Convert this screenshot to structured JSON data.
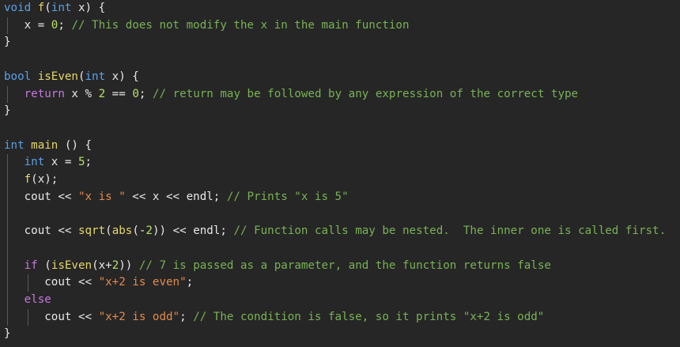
{
  "editor": {
    "theme": {
      "background": "#262626",
      "keyword": "#5aa0e6",
      "control": "#c678dd",
      "function": "#e6d66a",
      "number": "#b5e06a",
      "string": "#e28a4c",
      "comment": "#78b255",
      "text": "#e8e8e8"
    },
    "lines": [
      [
        {
          "c": "kw",
          "t": "void"
        },
        {
          "c": "tx",
          "t": " "
        },
        {
          "c": "fn",
          "t": "f"
        },
        {
          "c": "tx",
          "t": "("
        },
        {
          "c": "kw",
          "t": "int"
        },
        {
          "c": "tx",
          "t": " x) {"
        }
      ],
      [
        {
          "c": "tx",
          "t": "   x = "
        },
        {
          "c": "num",
          "t": "0"
        },
        {
          "c": "tx",
          "t": "; "
        },
        {
          "c": "cm",
          "t": "// This does not modify the x in the main function"
        }
      ],
      [
        {
          "c": "tx",
          "t": "}"
        }
      ],
      [],
      [
        {
          "c": "kw",
          "t": "bool"
        },
        {
          "c": "tx",
          "t": " "
        },
        {
          "c": "fn",
          "t": "isEven"
        },
        {
          "c": "tx",
          "t": "("
        },
        {
          "c": "kw",
          "t": "int"
        },
        {
          "c": "tx",
          "t": " x) {"
        }
      ],
      [
        {
          "c": "tx",
          "t": "   "
        },
        {
          "c": "kw2",
          "t": "return"
        },
        {
          "c": "tx",
          "t": " x % "
        },
        {
          "c": "num",
          "t": "2"
        },
        {
          "c": "tx",
          "t": " == "
        },
        {
          "c": "num",
          "t": "0"
        },
        {
          "c": "tx",
          "t": "; "
        },
        {
          "c": "cm",
          "t": "// return may be followed by any expression of the correct type"
        }
      ],
      [
        {
          "c": "tx",
          "t": "}"
        }
      ],
      [],
      [
        {
          "c": "kw",
          "t": "int"
        },
        {
          "c": "tx",
          "t": " "
        },
        {
          "c": "fn",
          "t": "main"
        },
        {
          "c": "tx",
          "t": " () {"
        }
      ],
      [
        {
          "c": "tx",
          "t": "   "
        },
        {
          "c": "kw",
          "t": "int"
        },
        {
          "c": "tx",
          "t": " x = "
        },
        {
          "c": "num",
          "t": "5"
        },
        {
          "c": "tx",
          "t": ";"
        }
      ],
      [
        {
          "c": "tx",
          "t": "   "
        },
        {
          "c": "fn",
          "t": "f"
        },
        {
          "c": "tx",
          "t": "(x);"
        }
      ],
      [
        {
          "c": "tx",
          "t": "   cout << "
        },
        {
          "c": "str",
          "t": "\"x is \""
        },
        {
          "c": "tx",
          "t": " << x << endl; "
        },
        {
          "c": "cm",
          "t": "// Prints \"x is 5\""
        }
      ],
      [],
      [
        {
          "c": "tx",
          "t": "   cout << "
        },
        {
          "c": "fn",
          "t": "sqrt"
        },
        {
          "c": "tx",
          "t": "("
        },
        {
          "c": "fn",
          "t": "abs"
        },
        {
          "c": "tx",
          "t": "(-"
        },
        {
          "c": "num",
          "t": "2"
        },
        {
          "c": "tx",
          "t": ")) << endl; "
        },
        {
          "c": "cm",
          "t": "// Function calls may be nested.  The inner one is called first."
        }
      ],
      [],
      [
        {
          "c": "tx",
          "t": "   "
        },
        {
          "c": "kw2",
          "t": "if"
        },
        {
          "c": "tx",
          "t": " ("
        },
        {
          "c": "fn",
          "t": "isEven"
        },
        {
          "c": "tx",
          "t": "(x+"
        },
        {
          "c": "num",
          "t": "2"
        },
        {
          "c": "tx",
          "t": ")) "
        },
        {
          "c": "cm",
          "t": "// 7 is passed as a parameter, and the function returns false"
        }
      ],
      [
        {
          "c": "tx",
          "t": "      cout << "
        },
        {
          "c": "str",
          "t": "\"x+2 is even\""
        },
        {
          "c": "tx",
          "t": ";"
        }
      ],
      [
        {
          "c": "tx",
          "t": "   "
        },
        {
          "c": "kw2",
          "t": "else"
        }
      ],
      [
        {
          "c": "tx",
          "t": "      cout << "
        },
        {
          "c": "str",
          "t": "\"x+2 is odd\""
        },
        {
          "c": "tx",
          "t": "; "
        },
        {
          "c": "cm",
          "t": "// The condition is false, so it prints \"x+2 is odd\""
        }
      ],
      [
        {
          "c": "tx",
          "t": "}"
        }
      ]
    ]
  }
}
